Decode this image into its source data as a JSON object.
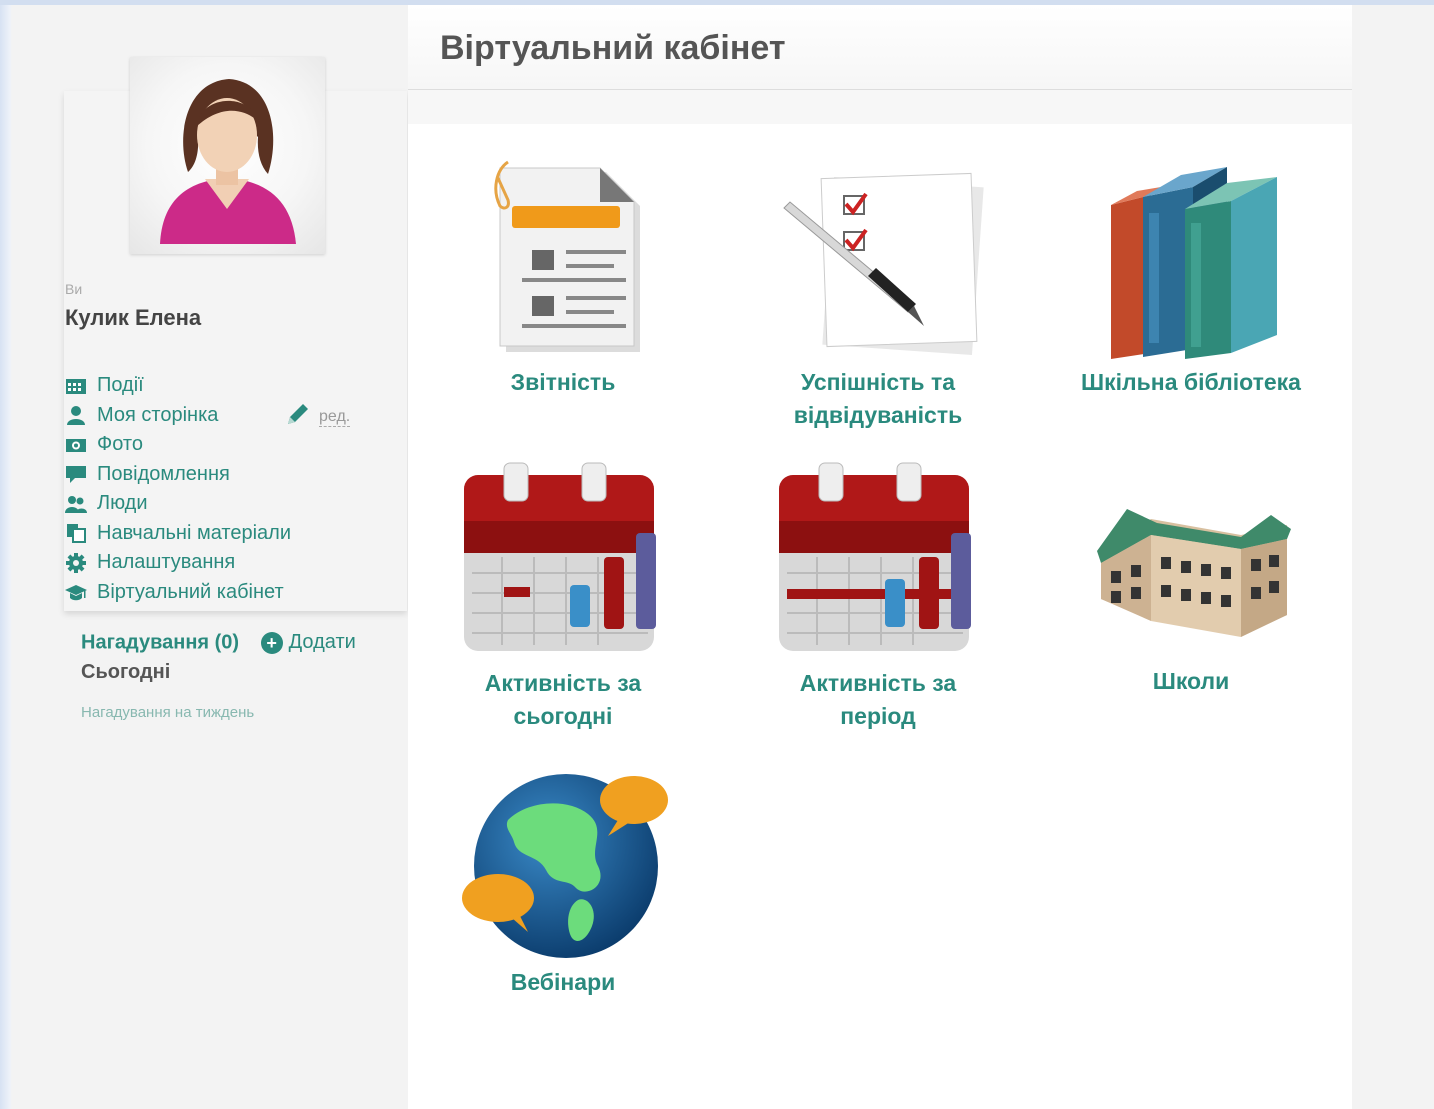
{
  "sidebar": {
    "you_label": "Ви",
    "user_name": "Кулик Елена",
    "edit_label": "ред.",
    "nav": [
      {
        "icon": "calendar-icon",
        "label": "Події"
      },
      {
        "icon": "user-icon",
        "label": "Моя сторінка"
      },
      {
        "icon": "camera-icon",
        "label": "Фото"
      },
      {
        "icon": "message-icon",
        "label": "Повідомлення"
      },
      {
        "icon": "people-icon",
        "label": "Люди"
      },
      {
        "icon": "documents-icon",
        "label": "Навчальні матеріали"
      },
      {
        "icon": "gear-icon",
        "label": "Налаштування"
      },
      {
        "icon": "graduation-cap-icon",
        "label": "Віртуальний кабінет"
      }
    ],
    "reminders": {
      "title": "Нагадування (0)",
      "add_label": "Додати",
      "today_label": "Сьогодні",
      "week_label": "Нагадування на тиждень"
    }
  },
  "main": {
    "title": "Віртуальний кабінет",
    "tiles": [
      {
        "icon": "report-document-icon",
        "label_lines": [
          "Звітність"
        ]
      },
      {
        "icon": "checklist-pen-icon",
        "label_lines": [
          "Успішність та",
          "відвідуваність"
        ]
      },
      {
        "icon": "books-icon",
        "label_lines": [
          "Шкільна бібліотека"
        ]
      },
      {
        "icon": "calendar-chart-icon",
        "label_lines": [
          "Активність за",
          "сьогодні"
        ]
      },
      {
        "icon": "calendar-chart-period-icon",
        "label_lines": [
          "Активність за",
          "період"
        ]
      },
      {
        "icon": "school-building-icon",
        "label_lines": [
          "Школи"
        ]
      },
      {
        "icon": "globe-chat-icon",
        "label_lines": [
          "Вебінари"
        ]
      }
    ]
  },
  "colors": {
    "accent": "#2a8a7e",
    "header_text": "#555555",
    "sidebar_bg": "#f3f3f3"
  }
}
